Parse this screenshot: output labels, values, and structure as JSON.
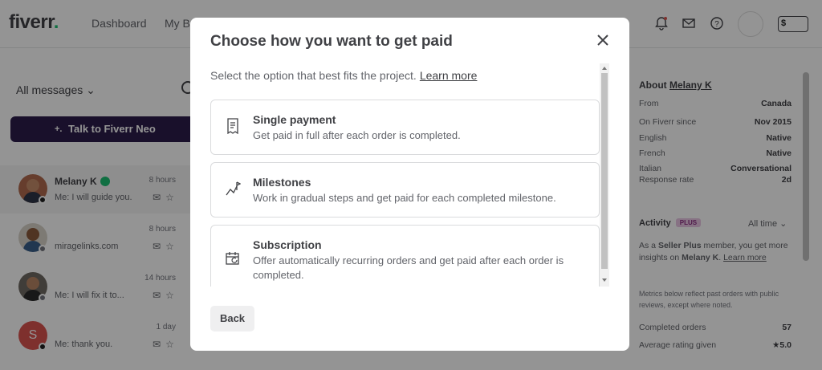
{
  "header": {
    "logo": "fiverr",
    "logo_dot": ".",
    "nav": [
      "Dashboard",
      "My Br"
    ],
    "icons": [
      "bell-icon",
      "mail-icon",
      "help-icon"
    ],
    "balance_label": "$"
  },
  "inbox": {
    "filter_label": "All messages",
    "neo_button": "Talk to Fiverr Neo",
    "neo_glyph": "+.",
    "conversations": [
      {
        "name": "Melany K",
        "time": "8 hours",
        "preview": "Me: I will guide you."
      },
      {
        "name": "",
        "time": "8 hours",
        "preview": "miragelinks.com"
      },
      {
        "name": "",
        "time": "14 hours",
        "preview": "Me: I will fix it to..."
      },
      {
        "name": "",
        "time": "1 day",
        "preview": "Me: thank you.",
        "initial": "S"
      }
    ]
  },
  "modal": {
    "title": "Choose how you want to get paid",
    "subtitle": "Select the option that best fits the project.",
    "learn_more": "Learn more",
    "options": [
      {
        "title": "Single payment",
        "description": "Get paid in full after each order is completed.",
        "icon": "receipt-icon"
      },
      {
        "title": "Milestones",
        "description": "Work in gradual steps and get paid for each completed milestone.",
        "icon": "milestone-flag-icon"
      },
      {
        "title": "Subscription",
        "description": "Offer automatically recurring orders and get paid after each order is completed.",
        "icon": "calendar-recurring-icon"
      }
    ],
    "back_button": "Back",
    "close_icon": "close-icon"
  },
  "about": {
    "heading_prefix": "About",
    "name": "Melany K",
    "rows": [
      {
        "label": "From",
        "value": "Canada"
      },
      {
        "label": "On Fiverr since",
        "value": "Nov 2015"
      },
      {
        "label": "English",
        "value": "Native"
      },
      {
        "label": "French",
        "value": "Native"
      },
      {
        "label": "Italian",
        "value": "Conversational"
      },
      {
        "label": "Response rate",
        "value": "2d"
      }
    ],
    "activity_label": "Activity",
    "plus_badge": "PLUS",
    "range_label": "All time",
    "seller_plus_text_1": "As a ",
    "seller_plus_bold": "Seller Plus",
    "seller_plus_text_2": " member, you get more insights on ",
    "seller_plus_name": "Melany K",
    "seller_plus_text_3": ". ",
    "seller_plus_link": "Learn more",
    "metrics_note": "Metrics below reflect past orders with public reviews, except where noted.",
    "stats": [
      {
        "label": "Completed orders",
        "value": "57"
      },
      {
        "label": "Average rating given",
        "value": "★5.0"
      }
    ]
  }
}
